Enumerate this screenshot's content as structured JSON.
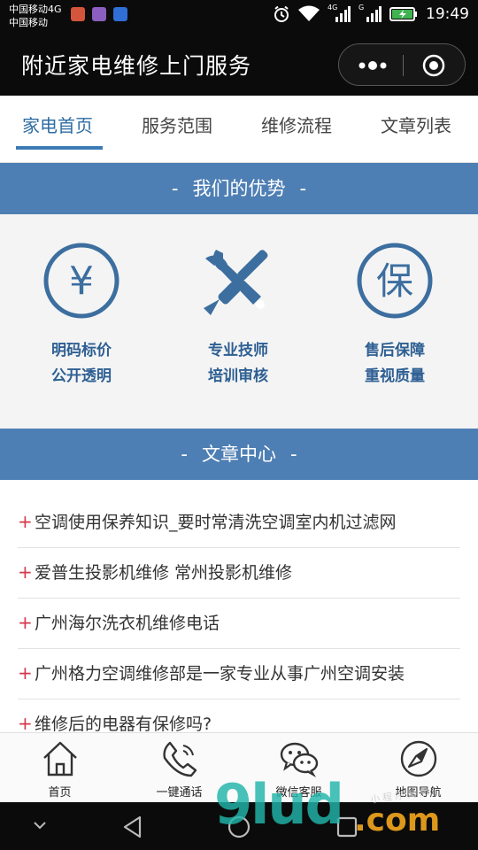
{
  "status_bar": {
    "carrier_line1": "中国移动4G",
    "carrier_line2": "中国移动",
    "net1": "4G",
    "net2": "G",
    "time": "19:49"
  },
  "header": {
    "title": "附近家电维修上门服务"
  },
  "tabs": [
    {
      "label": "家电首页",
      "active": true
    },
    {
      "label": "服务范围",
      "active": false
    },
    {
      "label": "维修流程",
      "active": false
    },
    {
      "label": "文章列表",
      "active": false
    }
  ],
  "advantages": {
    "heading": "我们的优势",
    "dash": "-",
    "items": [
      {
        "icon": "yen-circle-icon",
        "glyph": "¥",
        "line1": "明码标价",
        "line2": "公开透明"
      },
      {
        "icon": "wrench-screwdriver-icon",
        "line1": "专业技师",
        "line2": "培训审核"
      },
      {
        "icon": "guarantee-circle-icon",
        "glyph": "保",
        "line1": "售后保障",
        "line2": "重视质量"
      }
    ]
  },
  "articles": {
    "heading": "文章中心",
    "bullet": "+",
    "items": [
      "空调使用保养知识_要时常清洗空调室内机过滤网",
      "爱普生投影机维修 常州投影机维修",
      "广州海尔洗衣机维修电话",
      "广州格力空调维修部是一家专业从事广州空调安装",
      "维修后的电器有保修吗?"
    ]
  },
  "bottom_nav": [
    {
      "label": "首页",
      "icon": "home-icon"
    },
    {
      "label": "一键通话",
      "icon": "phone-icon"
    },
    {
      "label": "微信客服",
      "icon": "wechat-icon"
    },
    {
      "label": "地图导航",
      "icon": "compass-icon"
    }
  ],
  "watermark": {
    "main": "9lud",
    "suffix": ".com",
    "small": "小程序商店"
  },
  "colors": {
    "accent_blue": "#4e7fb4",
    "icon_blue": "#3c6e9f",
    "bullet_red": "#d4384b"
  }
}
